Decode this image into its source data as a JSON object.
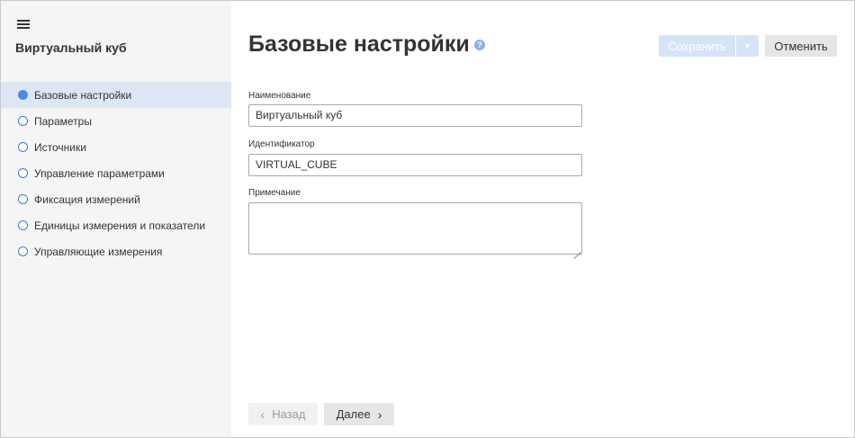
{
  "sidebar": {
    "menu_icon": "hamburger-menu-icon",
    "title": "Виртуальный куб",
    "items": [
      {
        "label": "Базовые настройки",
        "active": true
      },
      {
        "label": "Параметры",
        "active": false
      },
      {
        "label": "Источники",
        "active": false
      },
      {
        "label": "Управление параметрами",
        "active": false
      },
      {
        "label": "Фиксация измерений",
        "active": false
      },
      {
        "label": "Единицы измерения и показатели",
        "active": false
      },
      {
        "label": "Управляющие измерения",
        "active": false
      }
    ]
  },
  "header": {
    "title": "Базовые настройки",
    "help_icon": "question-circle-icon",
    "help_glyph": "?",
    "save_label": "Сохранить",
    "save_dropdown_icon": "caret-down-icon",
    "cancel_label": "Отменить"
  },
  "form": {
    "name_label": "Наименование",
    "name_value": "Виртуальный куб",
    "id_label": "Идентификатор",
    "id_value": "VIRTUAL_CUBE",
    "note_label": "Примечание",
    "note_value": ""
  },
  "footer": {
    "back_label": "Назад",
    "next_label": "Далее"
  },
  "colors": {
    "accent": "#4a8de0",
    "active_item_bg": "#dce7f3",
    "sidebar_bg": "#f5f5f5",
    "disabled_button_bg": "#d6e5f6"
  }
}
